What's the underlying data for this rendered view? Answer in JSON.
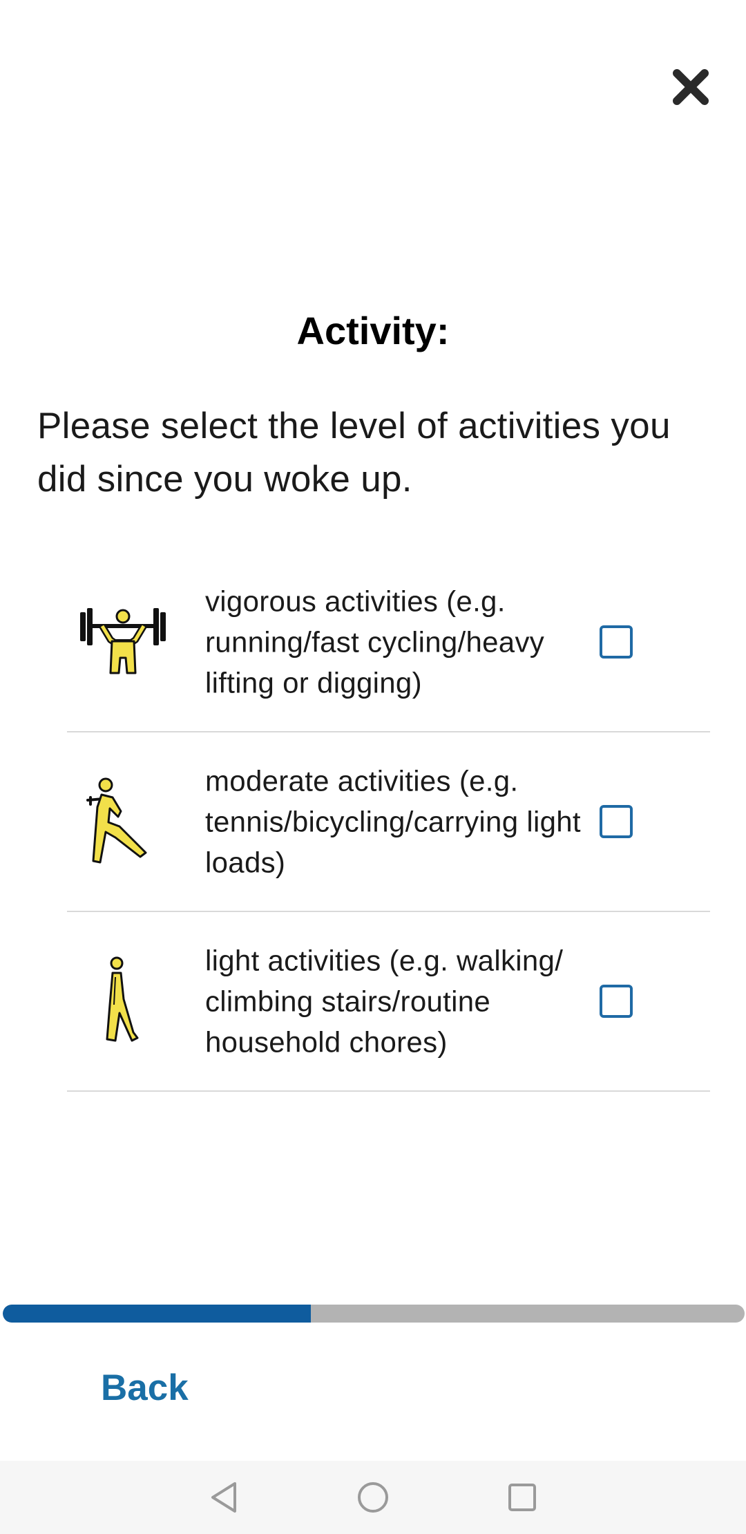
{
  "header": {
    "close_icon": "close-icon",
    "title": "Activity:"
  },
  "prompt": "Please select the level of activities you did since you woke up.",
  "options": [
    {
      "icon": "weightlifting-icon",
      "label": "vigorous activities (e.g. running/fast cycling/heavy lifting or digging)",
      "checked": false
    },
    {
      "icon": "tennis-player-icon",
      "label": "moderate activities (e.g. tennis/bicycling/carrying light loads)",
      "checked": false
    },
    {
      "icon": "walking-person-icon",
      "label": "light activities (e.g. walking/ climbing stairs/routine household chores)",
      "checked": false
    }
  ],
  "progress": {
    "fraction": 0.415
  },
  "footer": {
    "back_label": "Back"
  },
  "colors": {
    "accent": "#0f5c9e",
    "checkbox_border": "#1f6aa5",
    "back_text": "#1a6fa6",
    "progress_track": "#b3b3b3",
    "icon_fill": "#f2e04a"
  },
  "system_nav": {
    "back_icon": "nav-back-icon",
    "home_icon": "nav-home-icon",
    "recents_icon": "nav-recents-icon"
  }
}
